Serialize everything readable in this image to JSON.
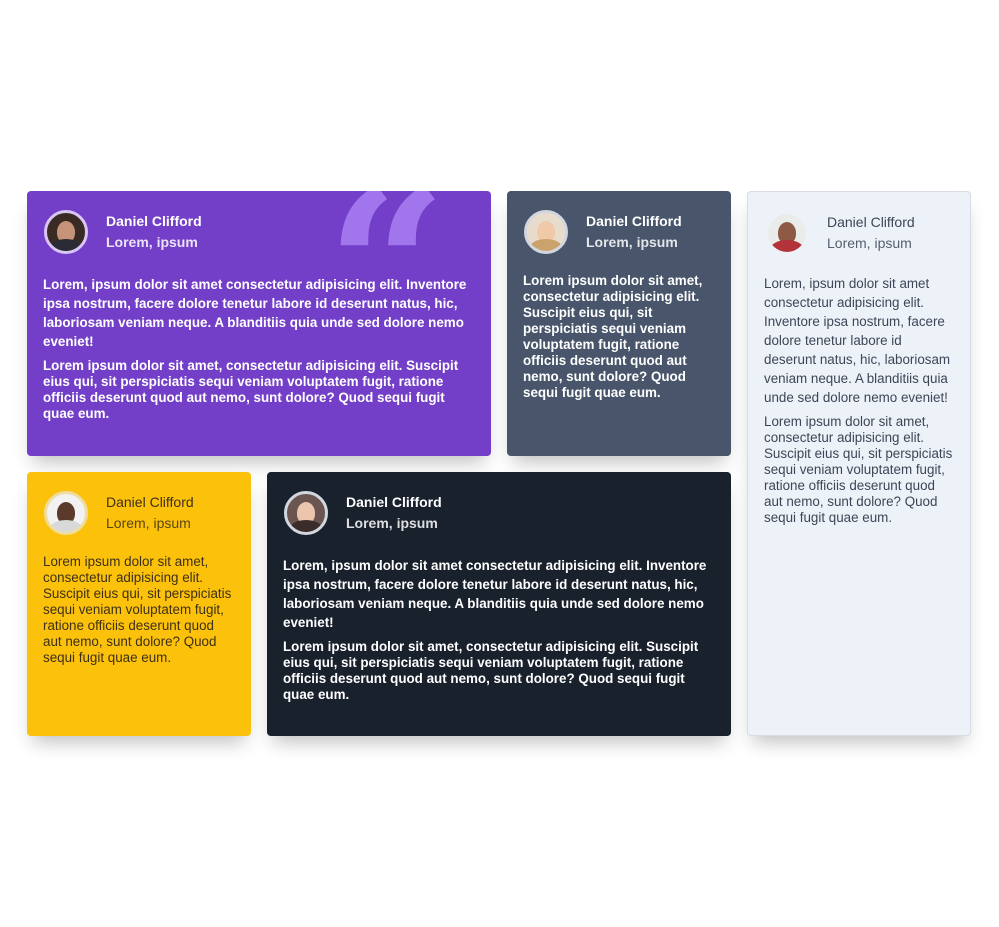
{
  "cards": [
    {
      "name": "Daniel Clifford",
      "role": "Lorem, ipsum",
      "p1": "Lorem, ipsum dolor sit amet consectetur adipisicing elit. Inventore ipsa nostrum, facere dolore tenetur labore id deserunt natus, hic, laboriosam veniam neque. A blanditiis quia unde sed dolore nemo eveniet!",
      "p2": "Lorem ipsum dolor sit amet, consectetur adipisicing elit. Suscipit eius qui, sit perspiciatis sequi veniam voluptatem fugit, ratione officiis deserunt quod aut nemo, sunt dolore? Quod sequi fugit quae eum.",
      "background": "#733fc8",
      "quote_mark": "“"
    },
    {
      "name": "Daniel Clifford",
      "role": "Lorem, ipsum",
      "p2": "Lorem ipsum dolor sit amet, consectetur adipisicing elit. Suscipit eius qui, sit perspiciatis sequi veniam voluptatem fugit, ratione officiis deserunt quod aut nemo, sunt dolore? Quod sequi fugit quae eum.",
      "background": "#48556a"
    },
    {
      "name": "Daniel Clifford",
      "role": "Lorem, ipsum",
      "p1": "Lorem, ipsum dolor sit amet consectetur adipisicing elit. Inventore ipsa nostrum, facere dolore tenetur labore id deserunt natus, hic, laboriosam veniam neque. A blanditiis quia unde sed dolore nemo eveniet!",
      "p2": "Lorem ipsum dolor sit amet, consectetur adipisicing elit. Suscipit eius qui, sit perspiciatis sequi veniam voluptatem fugit, ratione officiis deserunt quod aut nemo, sunt dolore? Quod sequi fugit quae eum.",
      "background": "#edf2f8"
    },
    {
      "name": "Daniel Clifford",
      "role": "Lorem, ipsum",
      "p2": "Lorem ipsum dolor sit amet, consectetur adipisicing elit. Suscipit eius qui, sit perspiciatis sequi veniam voluptatem fugit, ratione officiis deserunt quod aut nemo, sunt dolore? Quod sequi fugit quae eum.",
      "background": "#fcc20b"
    },
    {
      "name": "Daniel Clifford",
      "role": "Lorem, ipsum",
      "p1": "Lorem, ipsum dolor sit amet consectetur adipisicing elit. Inventore ipsa nostrum, facere dolore tenetur labore id deserunt natus, hic, laboriosam veniam neque. A blanditiis quia unde sed dolore nemo eveniet!",
      "p2": "Lorem ipsum dolor sit amet, consectetur adipisicing elit. Suscipit eius qui, sit perspiciatis sequi veniam voluptatem fugit, ratione officiis deserunt quod aut nemo, sunt dolore? Quod sequi fugit quae eum.",
      "background": "#19212d"
    }
  ]
}
